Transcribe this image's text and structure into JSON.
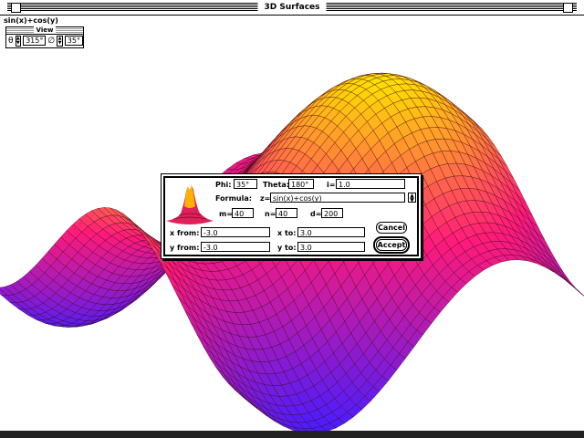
{
  "window": {
    "title": "3D Surfaces"
  },
  "formula_caption": "sin(x)+cos(y)",
  "view_palette": {
    "title": "View",
    "theta_value": "315°",
    "phi_value": "35°"
  },
  "dialog": {
    "phi_label": "Phi:",
    "phi_value": "35°",
    "theta_label": "Theta:",
    "theta_value": "180°",
    "i_label": "i=",
    "i_value": "1.0",
    "formula_label": "Formula:",
    "z_label": "z=",
    "formula_value": "sin(x)+cos(y)",
    "m_label": "m=",
    "m_value": "40",
    "n_label": "n=",
    "n_value": "40",
    "d_label": "d=",
    "d_value": "200",
    "xfrom_label": "x from:",
    "xfrom_value": "-3.0",
    "xto_label": "x to:",
    "xto_value": "3.0",
    "yfrom_label": "y from:",
    "yfrom_value": "-3.0",
    "yto_label": "y to:",
    "yto_value": "3.0",
    "cancel_label": "Cancel",
    "accept_label": "Accept"
  },
  "colors": {
    "surface_low": "#4a1cff",
    "surface_mid": "#ff1a7a",
    "surface_high": "#ffe000",
    "mesh": "#3a0010"
  }
}
